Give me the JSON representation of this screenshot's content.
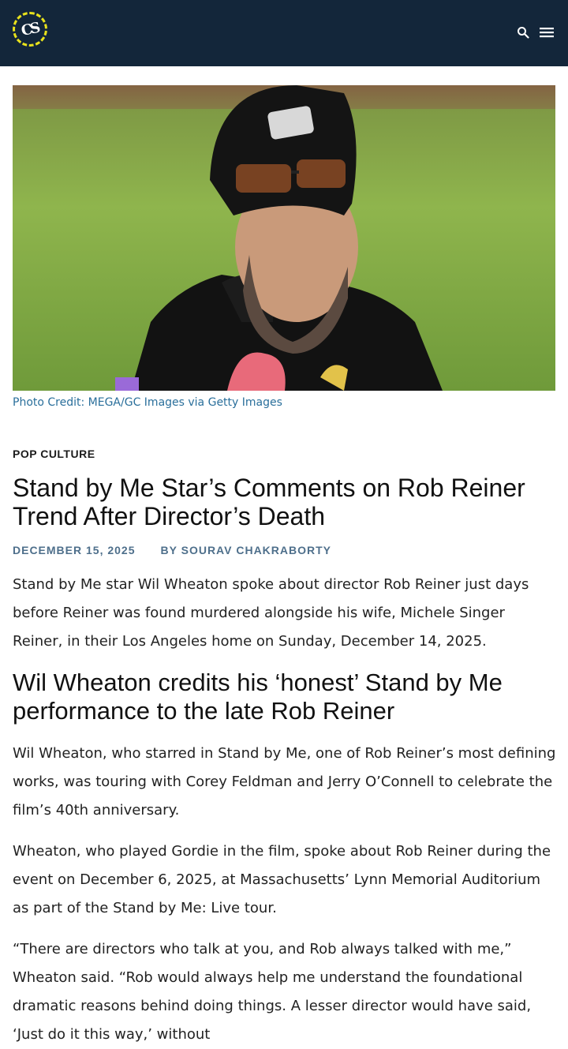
{
  "header": {
    "logo_text": "CS",
    "search_icon": "search-icon",
    "menu_icon": "menu-icon",
    "bg_color": "#13263a",
    "accent": "#e8e21c"
  },
  "hero": {
    "caption": "Photo Credit: MEGA/GC Images via Getty Images"
  },
  "article": {
    "category": "POP CULTURE",
    "title": "Stand by Me Star’s Comments on Rob Reiner Trend After Director’s Death",
    "date": "DECEMBER 15, 2025",
    "author": "BY SOURAV CHAKRABORTY",
    "intro": "Stand by Me star Wil Wheaton spoke about director Rob Reiner just days before Reiner was found murdered alongside his wife, Michele Singer Reiner, in their Los Angeles home on Sunday, December 14, 2025.",
    "subheading": "Wil Wheaton credits his ‘honest’ Stand by Me performance to the late Rob Reiner",
    "paragraphs": [
      "Wil Wheaton, who starred in Stand by Me, one of Rob Reiner’s most defining works, was touring with Corey Feldman and Jerry O’Connell to celebrate the film’s 40th anniversary.",
      "Wheaton, who played Gordie in the film, spoke about Rob Reiner during the event on December 6, 2025, at Massachusetts’ Lynn Memorial Auditorium as part of the Stand by Me: Live tour.",
      "“There are directors who talk at you, and Rob always talked with me,” Wheaton said. “Rob would always help me understand the foundational dramatic reasons behind doing things. A lesser director would have said, ‘Just do it this way,’ without"
    ]
  }
}
